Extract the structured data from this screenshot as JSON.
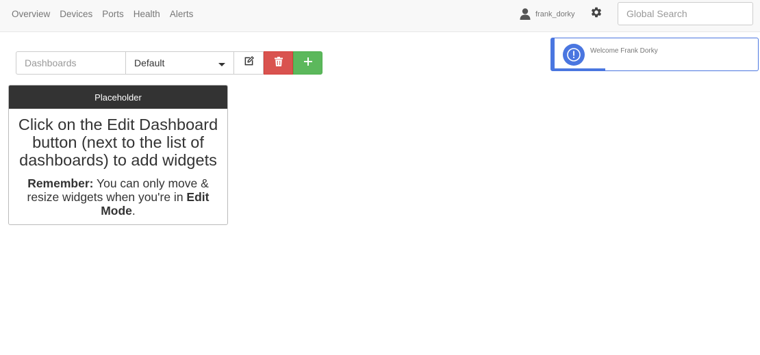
{
  "nav": {
    "items": [
      "Overview",
      "Devices",
      "Ports",
      "Health",
      "Alerts"
    ]
  },
  "user": {
    "name": "frank_dorky",
    "icon": "user-icon"
  },
  "settings": {
    "icon": "gear-icon"
  },
  "search": {
    "placeholder": "Global Search"
  },
  "dashboard_toolbar": {
    "dashboards_placeholder": "Dashboards",
    "selected": "Default",
    "edit_icon": "edit-icon",
    "delete_icon": "trash-icon",
    "add_icon": "plus-icon"
  },
  "toast": {
    "message": "Welcome Frank Dorky",
    "icon": "exclamation-circle-icon",
    "progress": 0.25,
    "color": "#4a76e0"
  },
  "widget": {
    "title": "Placeholder",
    "message": "Click on the Edit Dashboard button (next to the list of dashboards) to add widgets",
    "remember_label": "Remember:",
    "remember_text_1": " You can only move & resize widgets when you're in ",
    "remember_bold": "Edit Mode",
    "remember_end": "."
  },
  "colors": {
    "danger": "#d9534f",
    "success": "#5cb85c",
    "header_dark": "#333333"
  }
}
